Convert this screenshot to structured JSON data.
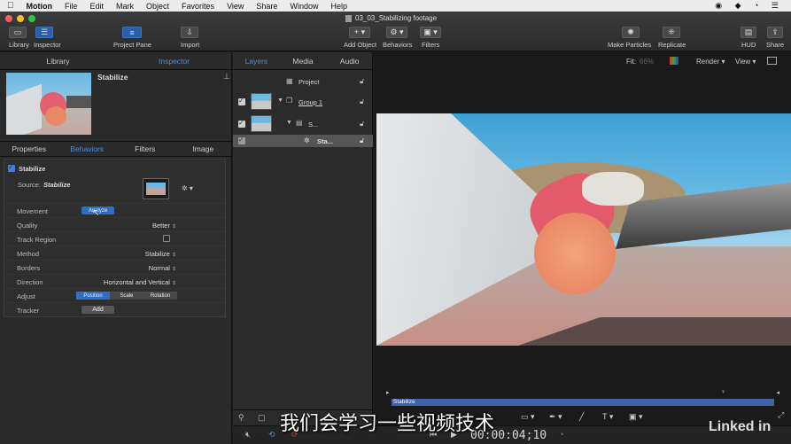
{
  "menubar": {
    "apple": "",
    "items": [
      "Motion",
      "File",
      "Edit",
      "Mark",
      "Object",
      "Favorites",
      "View",
      "Share",
      "Window",
      "Help"
    ]
  },
  "window": {
    "title": "03_03_Stabilizing footage"
  },
  "toolbar": {
    "library": "Library",
    "inspector": "Inspector",
    "project_pane": "Project Pane",
    "import": "Import",
    "add_object": "Add Object",
    "behaviors": "Behaviors",
    "filters": "Filters",
    "make_particles": "Make Particles",
    "replicate": "Replicate",
    "hud": "HUD",
    "share": "Share"
  },
  "left_panel": {
    "tabs": {
      "library": "Library",
      "inspector": "Inspector"
    },
    "preview_title": "Stabilize",
    "sub_tabs": [
      "Properties",
      "Behaviors",
      "Filters",
      "Image"
    ],
    "active_sub_tab": "Behaviors",
    "behavior": {
      "name": "Stabilize",
      "source_label": "Source:",
      "source_value": "Stabilize",
      "rows": {
        "movement": {
          "label": "Movement",
          "button": "Analyze"
        },
        "quality": {
          "label": "Quality",
          "value": "Better"
        },
        "track_region": {
          "label": "Track Region"
        },
        "method": {
          "label": "Method",
          "value": "Stabilize"
        },
        "borders": {
          "label": "Borders",
          "value": "Normal"
        },
        "direction": {
          "label": "Direction",
          "value": "Horizontal and Vertical"
        },
        "adjust": {
          "label": "Adjust",
          "options": [
            "Position",
            "Scale",
            "Rotation"
          ],
          "active": "Position"
        },
        "tracker": {
          "label": "Tracker",
          "button": "Add"
        }
      }
    }
  },
  "layers_panel": {
    "tabs": [
      "Layers",
      "Media",
      "Audio"
    ],
    "active_tab": "Layers",
    "items": [
      {
        "name": "Project"
      },
      {
        "name": "Group 1"
      },
      {
        "name": "S..."
      },
      {
        "name": "Sta..."
      }
    ]
  },
  "canvas": {
    "fit_label": "Fit:",
    "fit_value": "66%",
    "render": "Render",
    "view": "View",
    "timebar_label": "Stabilize"
  },
  "timing": {
    "timecode": "00:00:04;10"
  },
  "subtitle": "我们会学习一些视频技术",
  "watermark": "Linked in",
  "colors": {
    "accent": "#2c6fc7",
    "timebar": "#3d63a8"
  }
}
